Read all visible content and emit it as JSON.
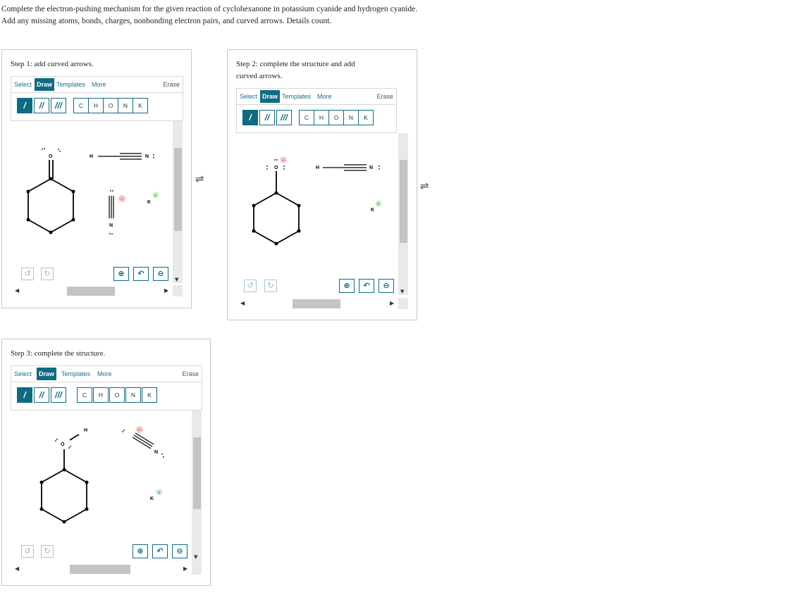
{
  "instructions": {
    "line1": "Complete the electron-pushing mechanism for the given reaction of cyclohexanone in potassium cyanide and hydrogen cyanide.",
    "line2": "Add any missing atoms, bonds, charges, nonbonding electron pairs, and curved arrows. Details count."
  },
  "toolbar": {
    "tabs": {
      "select": "Select",
      "draw": "Draw",
      "templates": "Templates",
      "more": "More",
      "erase": "Erase"
    },
    "bonds": {
      "single": "/",
      "double": "//",
      "triple": "///"
    },
    "atoms": [
      "C",
      "H",
      "O",
      "N",
      "K"
    ]
  },
  "steps": [
    {
      "title": "Step 1: add curved arrows."
    },
    {
      "title_line1": "Step 2: complete the structure and add",
      "title_line2": "curved arrows."
    },
    {
      "title": "Step 3: complete the structure."
    }
  ],
  "equilibrium_symbol": "⇌",
  "icons": {
    "undo": "undo-icon",
    "redo": "redo-icon",
    "zoom_in": "zoom-in-icon",
    "reset": "reset-zoom-icon",
    "zoom_out": "zoom-out-icon"
  },
  "glyphs": {
    "undo": "↺",
    "redo": "↻",
    "zoom_in": "⊕",
    "reset": "↶",
    "zoom_out": "⊖",
    "caret": "▼",
    "left": "◀",
    "right": "▶"
  },
  "labels": {
    "O": "O",
    "H": "H",
    "N": "N",
    "K": "K",
    "plus": "+",
    "minus": "−"
  }
}
